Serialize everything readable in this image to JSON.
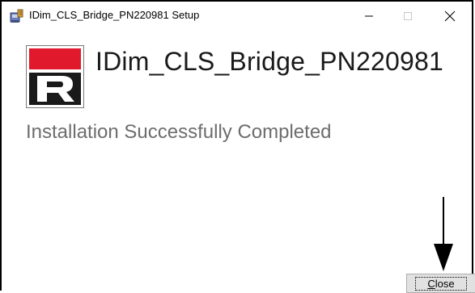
{
  "window": {
    "title": "IDim_CLS_Bridge_PN220981 Setup",
    "controls": {
      "minimize_icon": "minimize-icon",
      "maximize_icon": "maximize-icon",
      "close_icon": "close-icon"
    }
  },
  "logo": {
    "letter": "R",
    "colors": {
      "red": "#e0192d",
      "black": "#1a1a1a"
    }
  },
  "main": {
    "product_name": "IDim_CLS_Bridge_PN220981",
    "status": "Installation Successfully Completed"
  },
  "footer": {
    "close_button": {
      "mnemonic": "C",
      "rest": "lose"
    }
  }
}
